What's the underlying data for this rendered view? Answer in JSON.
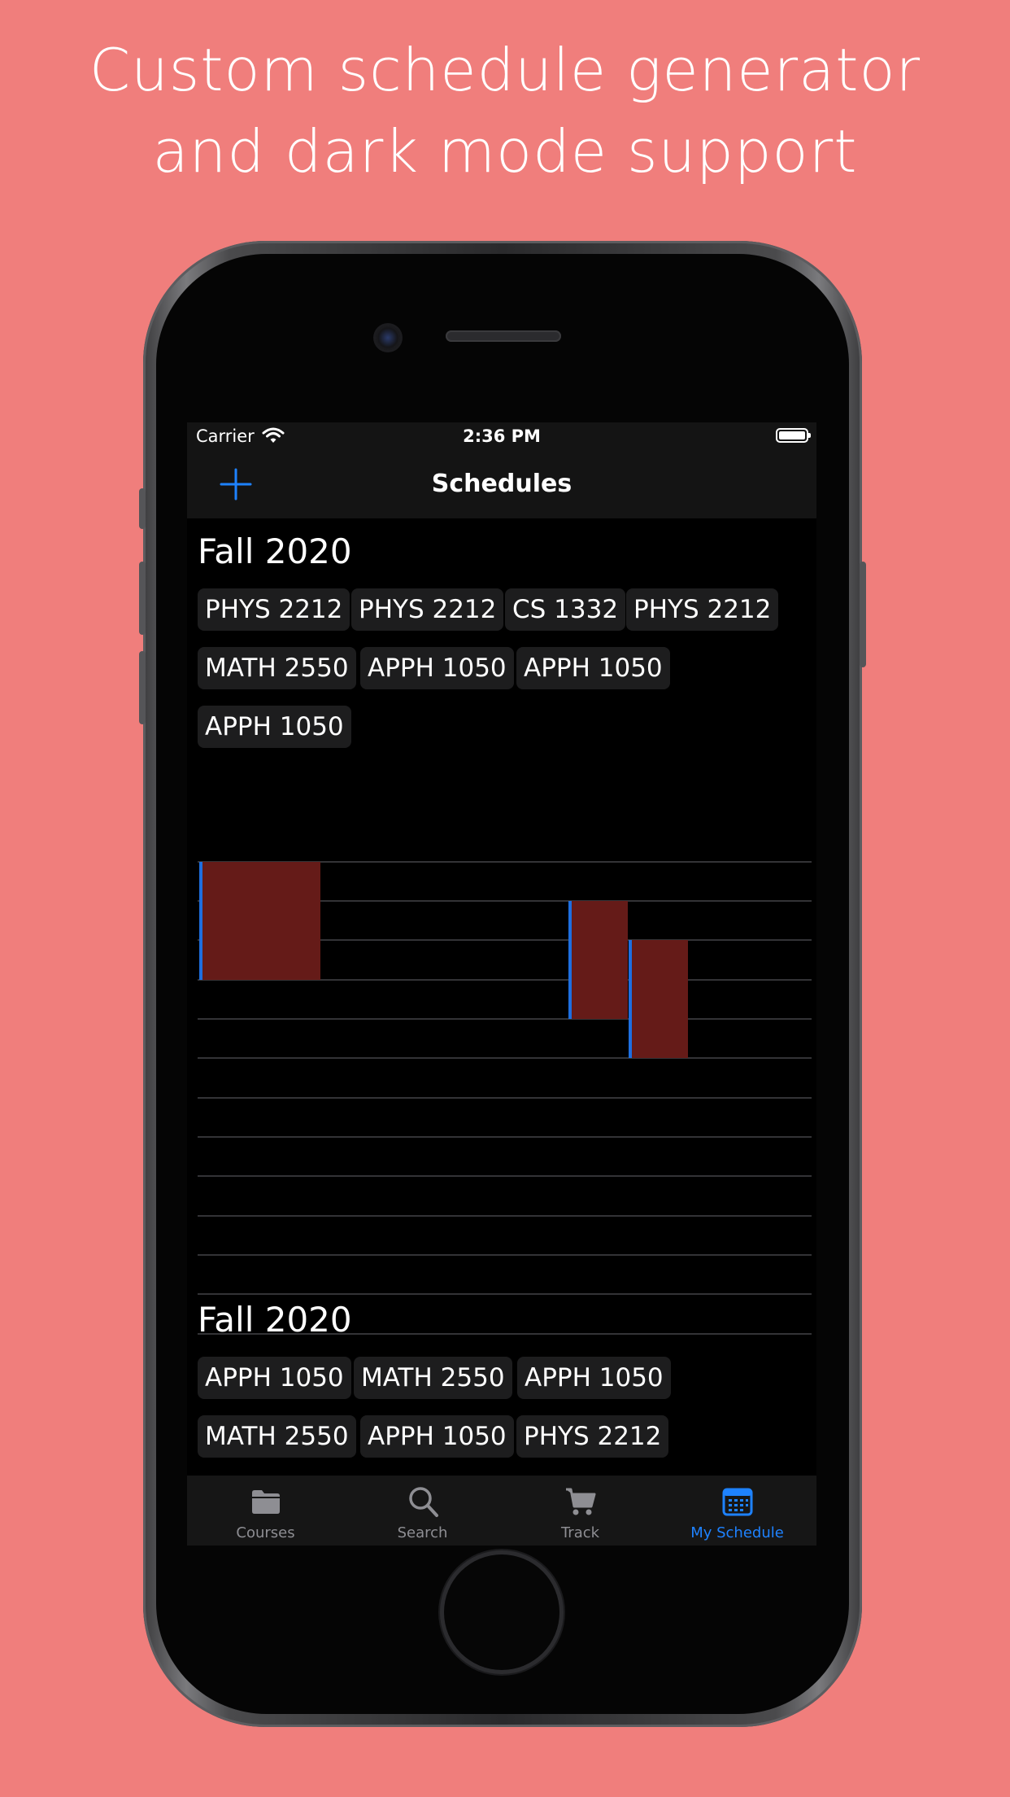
{
  "headline": {
    "line1": "Custom schedule generator",
    "line2": "and dark mode support"
  },
  "status_bar": {
    "carrier": "Carrier",
    "time": "2:36 PM"
  },
  "nav": {
    "title": "Schedules",
    "add_icon": "plus-icon"
  },
  "schedules": [
    {
      "term": "Fall 2020",
      "courses": [
        "PHYS 2212",
        "PHYS 2212",
        "CS 1332",
        "PHYS 2212",
        "MATH 2550",
        "APPH 1050",
        "APPH 1050",
        "APPH 1050"
      ]
    },
    {
      "term": "Fall 2020",
      "courses": [
        "APPH 1050",
        "MATH 2550",
        "APPH 1050",
        "MATH 2550",
        "APPH 1050",
        "PHYS 2212"
      ]
    }
  ],
  "calendar": {
    "block_color": "#651b18",
    "accent_color": "#1e6fe0",
    "grid_rows": 12
  },
  "tab_bar": {
    "items": [
      {
        "label": "Courses",
        "icon": "folder-icon",
        "active": false
      },
      {
        "label": "Search",
        "icon": "search-icon",
        "active": false
      },
      {
        "label": "Track",
        "icon": "cart-icon",
        "active": false
      },
      {
        "label": "My Schedule",
        "icon": "calendar-icon",
        "active": true
      }
    ],
    "active_color": "#1e82ff",
    "inactive_color": "#8e8e93"
  },
  "background_color": "#f07e7c"
}
